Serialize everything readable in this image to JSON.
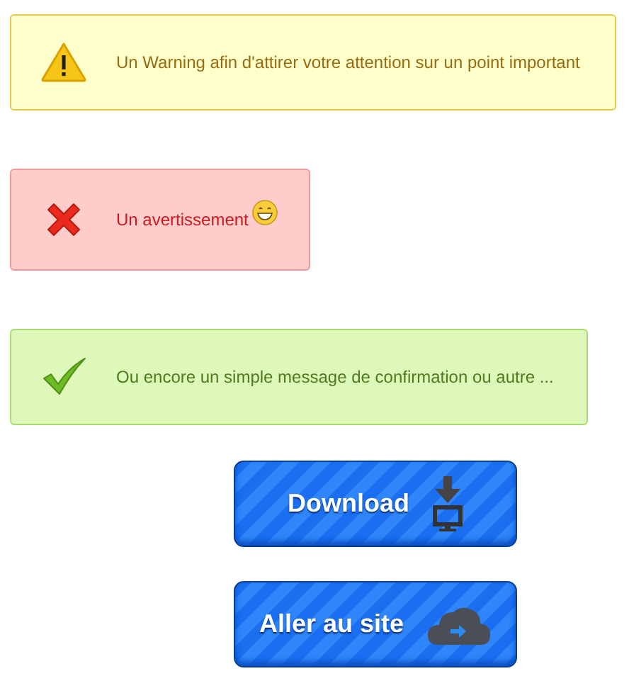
{
  "alerts": [
    {
      "kind": "warning",
      "text": "Un Warning afin d'attirer votre attention sur un point important",
      "emoji": false
    },
    {
      "kind": "error",
      "text": "Un avertissement",
      "emoji": true
    },
    {
      "kind": "success",
      "text": "Ou encore un simple message de confirmation ou autre ...",
      "emoji": false
    }
  ],
  "buttons": [
    {
      "kind": "download",
      "label": "Download"
    },
    {
      "kind": "site",
      "label": "Aller au site"
    }
  ]
}
